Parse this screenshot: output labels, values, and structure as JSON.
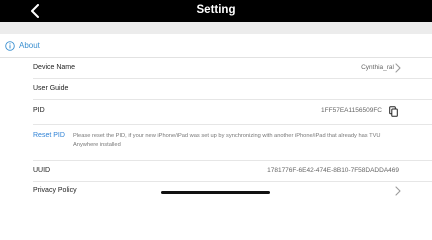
{
  "header": {
    "title": "Setting"
  },
  "section": {
    "title": "About"
  },
  "rows": {
    "device_name": {
      "label": "Device Name",
      "value": "Cynthia_ral"
    },
    "user_guide": {
      "label": "User Guide"
    },
    "pid": {
      "label": "PID",
      "value": "1FF57EA1156509FC"
    },
    "reset": {
      "link": "Reset PID",
      "description": "Please reset the PID, if your new iPhone/iPad was set up by synchronizing with another iPhone/iPad that already has TVU Anywhere installed"
    },
    "uuid": {
      "label": "UUID",
      "value": "1781776F-6E42-474E-8B10-7F58DADDA469"
    },
    "privacy": {
      "label": "Privacy Policy"
    }
  },
  "colors": {
    "accent": "#3a8fd0",
    "link": "#2f82d6",
    "topbar": "#000000",
    "band": "#ececec"
  },
  "icons": [
    "back-arrow-icon",
    "info-icon",
    "chevron-right-icon",
    "copy-icon"
  ]
}
